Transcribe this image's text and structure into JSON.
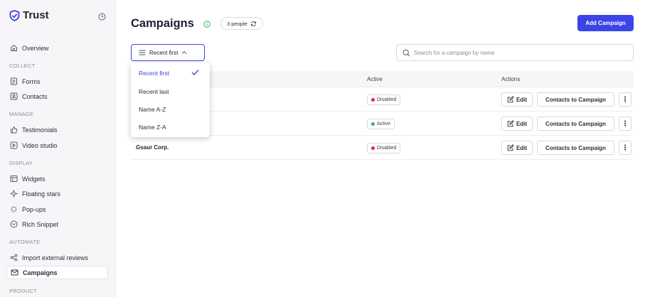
{
  "brand": {
    "name": "Trust",
    "accent": "#3b44e6"
  },
  "sidebar": {
    "items": [
      {
        "label": "Overview",
        "icon": "home-icon"
      },
      {
        "section": "COLLECT"
      },
      {
        "label": "Forms",
        "icon": "form-icon"
      },
      {
        "label": "Contacts",
        "icon": "contact-card-icon"
      },
      {
        "section": "MANAGE"
      },
      {
        "label": "Testimonials",
        "icon": "thumbs-up-icon"
      },
      {
        "label": "Video studio",
        "icon": "play-icon"
      },
      {
        "section": "DISPLAY"
      },
      {
        "label": "Widgets",
        "icon": "widget-icon"
      },
      {
        "label": "Floating stars",
        "icon": "star-icon"
      },
      {
        "label": "Pop-ups",
        "icon": "sparkle-icon"
      },
      {
        "label": "Rich Snippet",
        "icon": "snippet-icon"
      },
      {
        "section": "AUTOMATE"
      },
      {
        "label": "Import external reviews",
        "icon": "share-icon"
      },
      {
        "label": "Campaigns",
        "icon": "mail-icon",
        "active": true
      },
      {
        "section": "PRODUCT"
      }
    ]
  },
  "header": {
    "title": "Campaigns",
    "people_count": "3 people",
    "add_button": "Add Campaign"
  },
  "toolbar": {
    "sort_label": "Recent first",
    "search_placeholder": "Search for a campaign by name"
  },
  "table": {
    "columns": [
      "Active",
      "Actions"
    ],
    "rows": [
      {
        "name": "",
        "status": "Disabled",
        "status_color": "#e0262b"
      },
      {
        "name": "",
        "status": "Active",
        "status_color": "#2fb65a"
      },
      {
        "name": "Gsaur Corp.",
        "status": "Disabled",
        "status_color": "#e0262b"
      }
    ],
    "edit_label": "Edit",
    "contacts_label": "Contacts to Campaign",
    "more_label": "⋮"
  },
  "sort_dropdown": {
    "options": [
      "Recent first",
      "Recent last",
      "Name A-Z",
      "Name Z-A"
    ],
    "selected": "Recent first"
  }
}
